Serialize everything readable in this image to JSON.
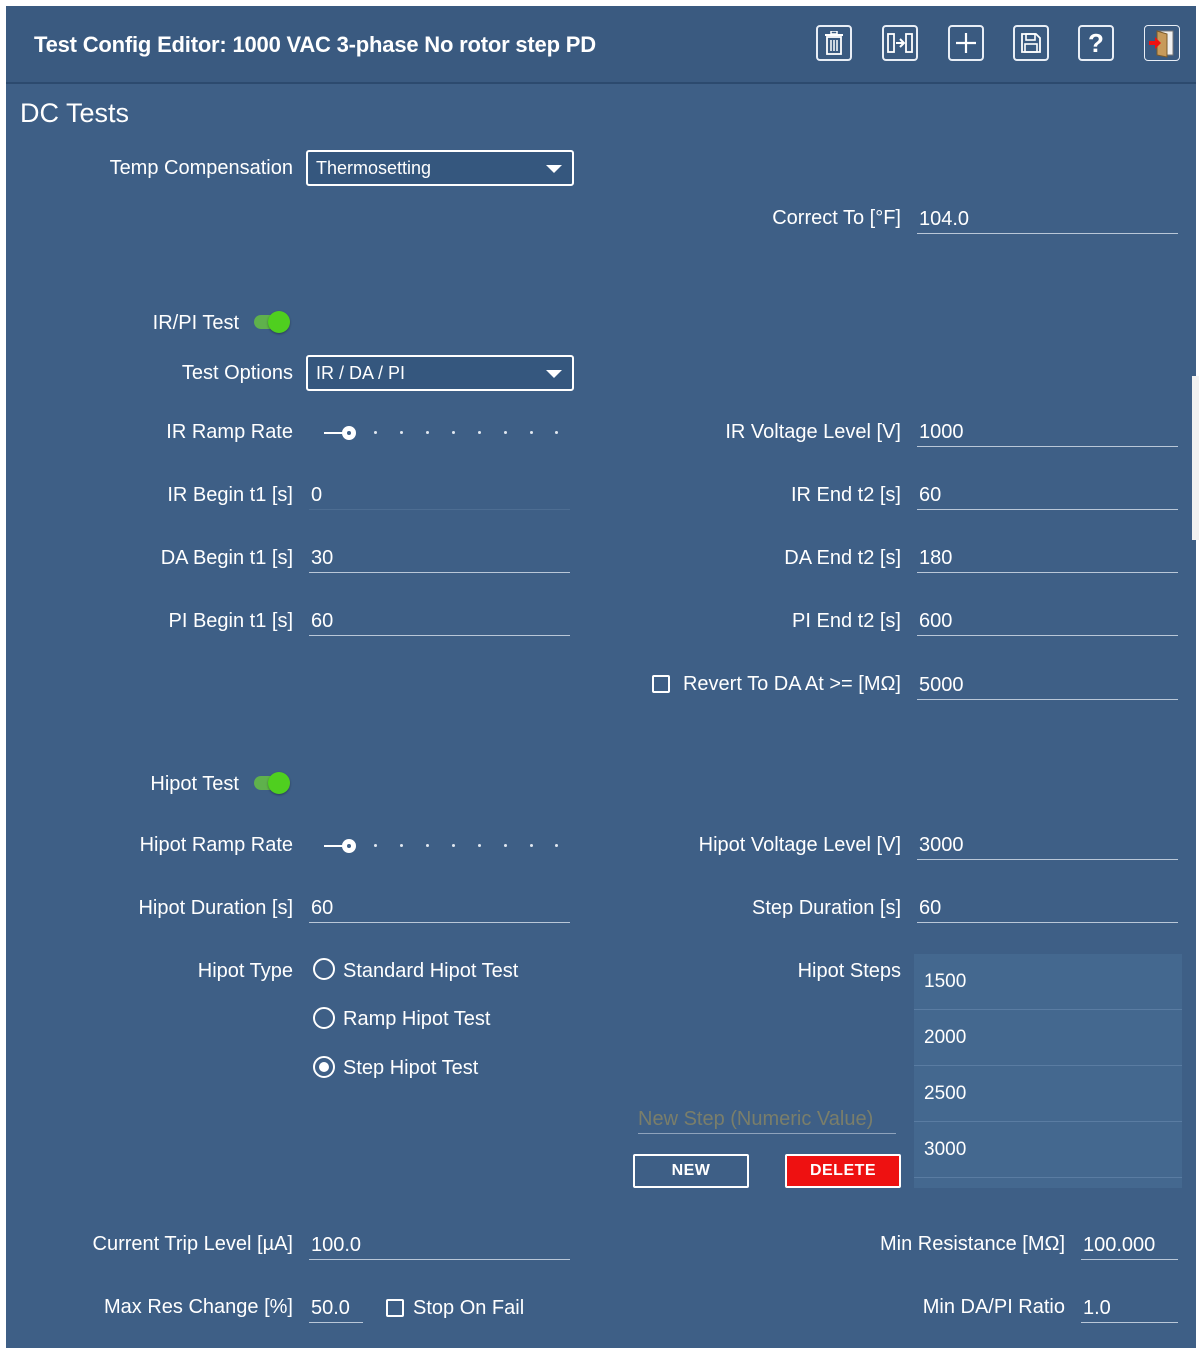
{
  "window": {
    "title": "Test Config Editor: 1000 VAC 3-phase No rotor step PD",
    "toolbar": [
      "trash-icon",
      "export-icon",
      "plus-icon",
      "save-icon",
      "help-icon",
      "exit-icon"
    ]
  },
  "section": {
    "title": "DC Tests"
  },
  "temp": {
    "label": "Temp Compensation",
    "value": "Thermosetting",
    "correct_to_label": "Correct To [°F]",
    "correct_to_value": "104.0"
  },
  "ir": {
    "toggle_label": "IR/PI Test",
    "enabled": true,
    "options_label": "Test Options",
    "options_value": "IR / DA / PI",
    "ramp_label": "IR Ramp Rate",
    "ramp_level": 1,
    "voltage_label": "IR Voltage Level [V]",
    "voltage_value": "1000",
    "begin_label": "IR Begin t1 [s]",
    "begin_value": "0",
    "end_label": "IR End t2 [s]",
    "end_value": "60",
    "da_begin_label": "DA Begin t1 [s]",
    "da_begin_value": "30",
    "da_end_label": "DA End t2 [s]",
    "da_end_value": "180",
    "pi_begin_label": "PI Begin t1 [s]",
    "pi_begin_value": "60",
    "pi_end_label": "PI End t2 [s]",
    "pi_end_value": "600",
    "revert_label": "Revert To DA At >= [MΩ]",
    "revert_checked": false,
    "revert_value": "5000"
  },
  "hipot": {
    "toggle_label": "Hipot Test",
    "enabled": true,
    "ramp_label": "Hipot Ramp Rate",
    "ramp_level": 1,
    "voltage_label": "Hipot Voltage Level [V]",
    "voltage_value": "3000",
    "duration_label": "Hipot Duration [s]",
    "duration_value": "60",
    "step_duration_label": "Step Duration [s]",
    "step_duration_value": "60",
    "type_label": "Hipot Type",
    "types": [
      "Standard Hipot Test",
      "Ramp Hipot Test",
      "Step Hipot Test"
    ],
    "selected_type": "Step Hipot Test",
    "steps_label": "Hipot Steps",
    "steps": [
      "1500",
      "2000",
      "2500",
      "3000"
    ],
    "new_step_placeholder": "New Step (Numeric Value)",
    "new_button": "NEW",
    "delete_button": "DELETE"
  },
  "limits": {
    "trip_label": "Current Trip Level [µA]",
    "trip_value": "100.0",
    "min_res_label": "Min Resistance [MΩ]",
    "min_res_value": "100.000",
    "max_res_label": "Max Res Change [%]",
    "max_res_value": "50.0",
    "stop_on_fail_label": "Stop On Fail",
    "stop_on_fail_checked": false,
    "min_ratio_label": "Min DA/PI Ratio",
    "min_ratio_value": "1.0"
  },
  "colors": {
    "background": "#3e5f86",
    "toggle_on": "#4fcf1f",
    "delete": "#ee1111"
  }
}
